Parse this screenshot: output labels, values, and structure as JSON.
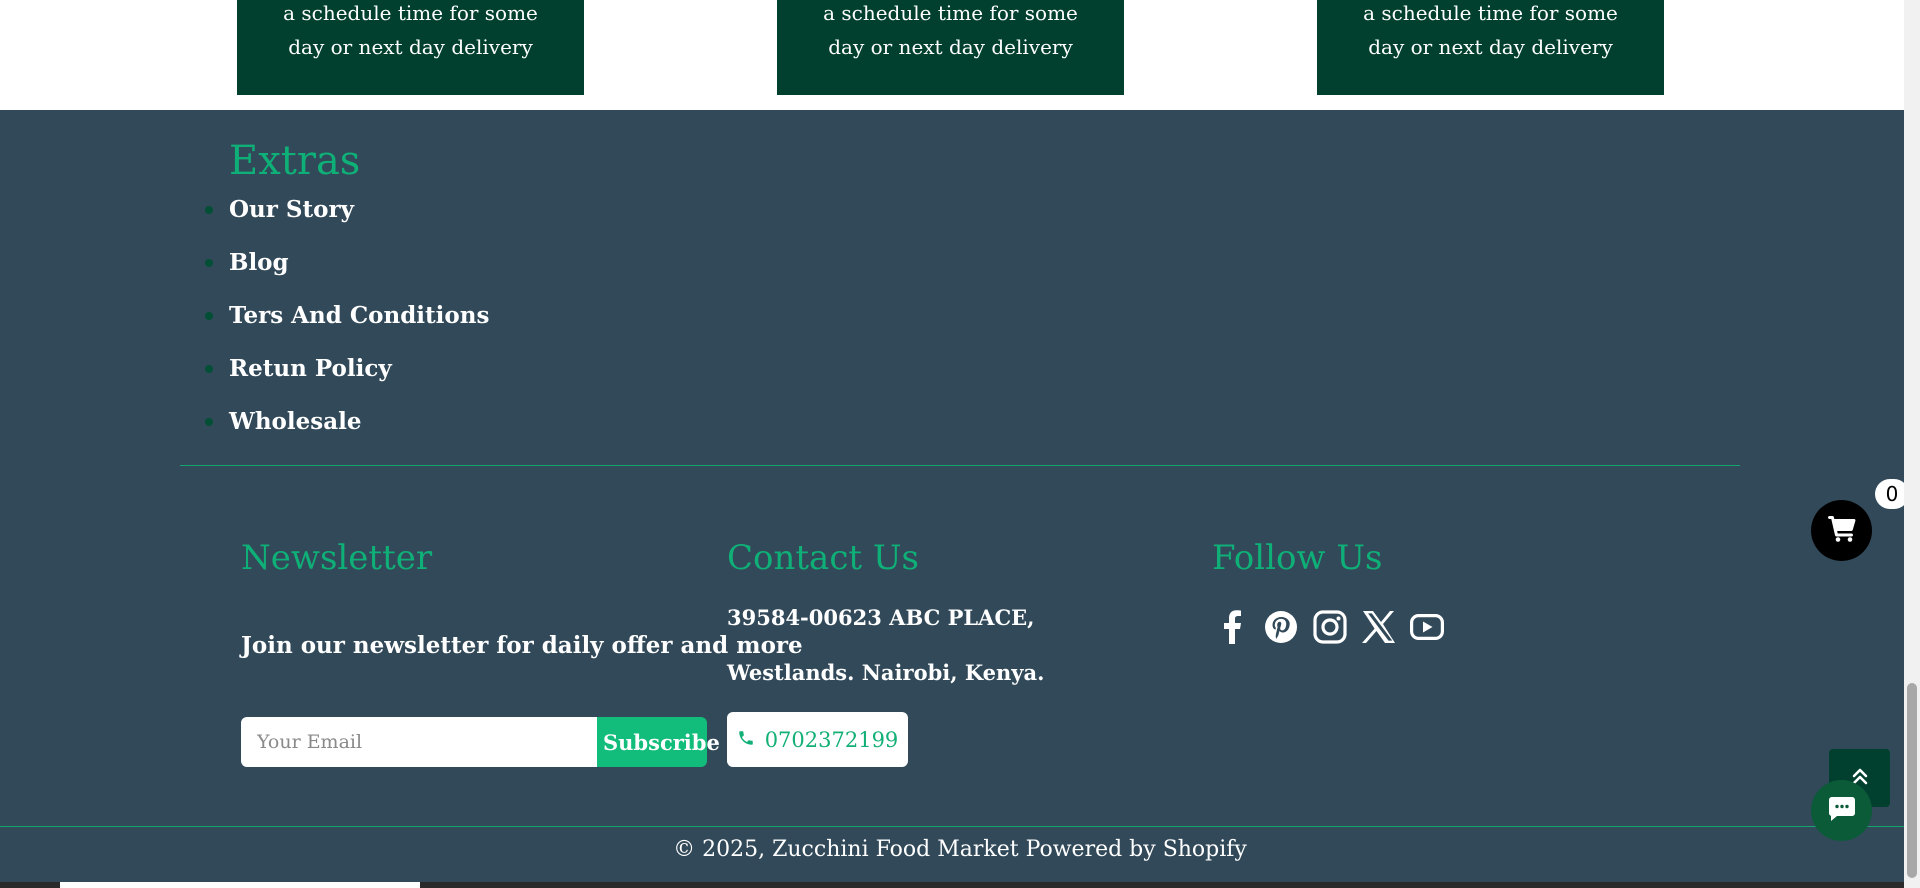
{
  "features": {
    "cards": [
      {
        "line1": "a schedule time for some",
        "line2": "day or next day delivery"
      },
      {
        "line1": "a schedule time for some",
        "line2": "day or next day delivery"
      },
      {
        "line1": "a schedule time for some",
        "line2": "day or next day delivery"
      }
    ]
  },
  "footer": {
    "extras": {
      "title": "Extras",
      "links": [
        "Our Story",
        "Blog",
        "Ters And Conditions",
        "Retun Policy",
        "Wholesale"
      ]
    },
    "newsletter": {
      "title": "Newsletter",
      "text": "Join our newsletter for daily offer and more",
      "email_placeholder": "Your Email",
      "email_value": "",
      "subscribe_label": "Subscribe"
    },
    "contact": {
      "title": "Contact Us",
      "address_line1": "39584-00623 ABC PLACE,",
      "address_line2": "Westlands. Nairobi, Kenya.",
      "phone": "0702372199"
    },
    "follow": {
      "title": "Follow Us",
      "icons": [
        "facebook-icon",
        "pinterest-icon",
        "instagram-icon",
        "x-icon",
        "youtube-icon"
      ]
    },
    "copyright": "© 2025, Zucchini Food Market Powered by Shopify"
  },
  "floating": {
    "cart_count": "0"
  },
  "colors": {
    "accent_green": "#0fb077",
    "dark_green": "#01402e",
    "footer_bg": "#314959",
    "subscribe_green": "#12bd7b"
  }
}
